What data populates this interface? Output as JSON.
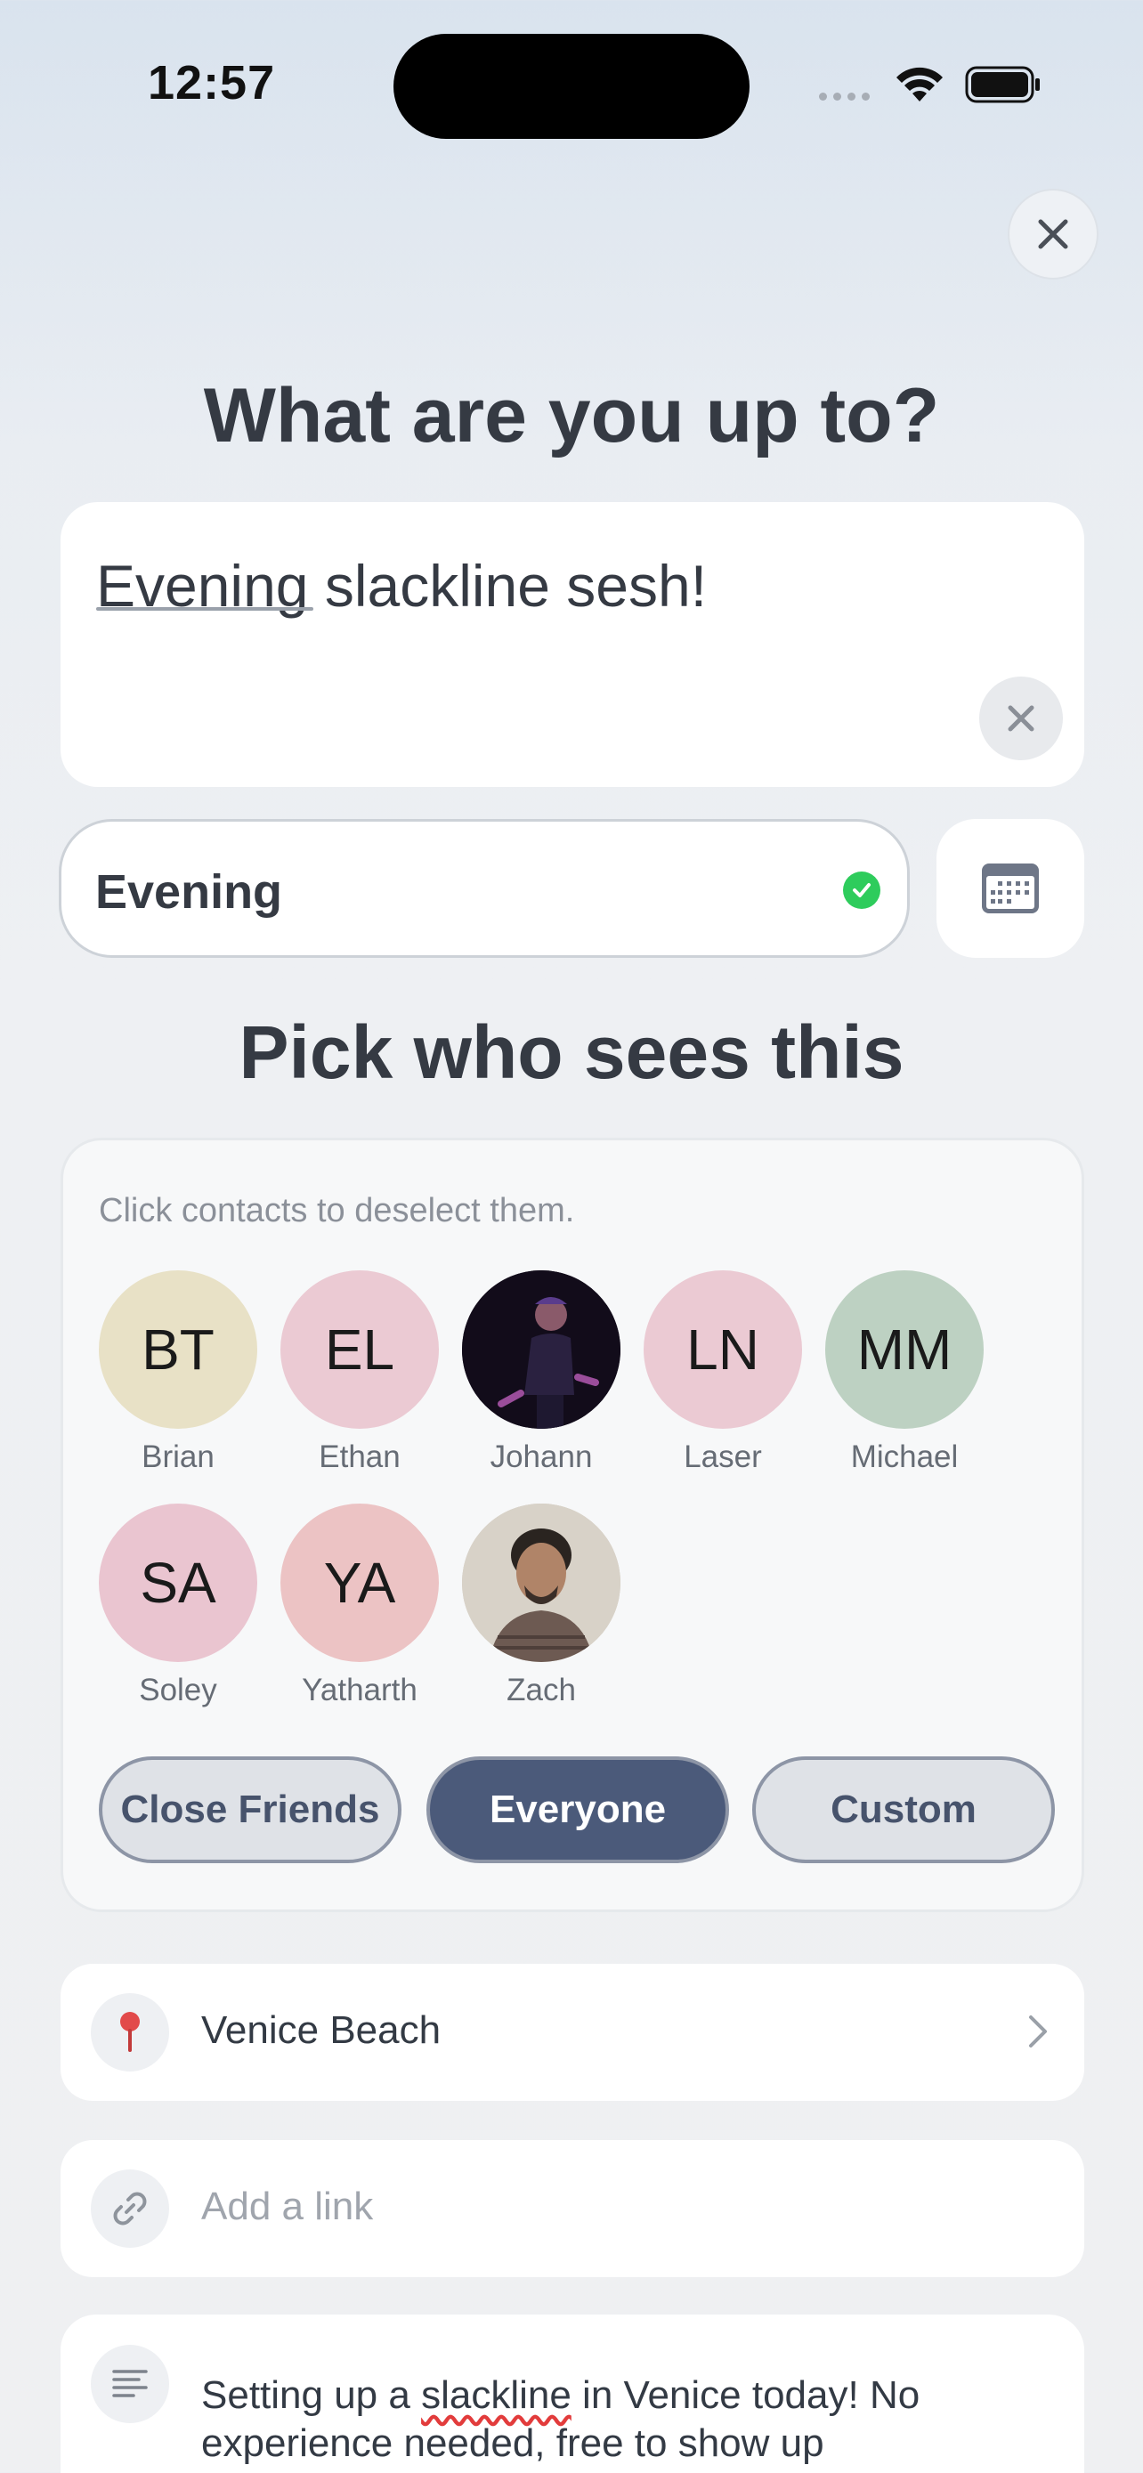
{
  "status_bar": {
    "time": "12:57"
  },
  "header": {
    "title": "What are you up to?"
  },
  "activity": {
    "value_underlined": "Evening",
    "value_rest": " slackline sesh!"
  },
  "time_field": {
    "value": "Evening"
  },
  "audience": {
    "title": "Pick who sees this",
    "hint": "Click contacts to deselect them.",
    "contacts": [
      {
        "initials": "BT",
        "name": "Brian",
        "color": "#e8e1c6"
      },
      {
        "initials": "EL",
        "name": "Ethan",
        "color": "#ebcad3"
      },
      {
        "initials": "",
        "name": "Johann",
        "color": "#1a1424",
        "photo": true
      },
      {
        "initials": "LN",
        "name": "Laser",
        "color": "#ebcad3"
      },
      {
        "initials": "MM",
        "name": "Michael",
        "color": "#bdd1c2"
      },
      {
        "initials": "SA",
        "name": "Soley",
        "color": "#eac5d0"
      },
      {
        "initials": "YA",
        "name": "Yatharth",
        "color": "#ecc3c4"
      },
      {
        "initials": "",
        "name": "Zach",
        "color": "#c9bfb1",
        "photo": true
      }
    ],
    "segments": [
      "Close Friends",
      "Everyone",
      "Custom"
    ],
    "selected_segment": "Everyone"
  },
  "location": {
    "value": "Venice Beach"
  },
  "link": {
    "placeholder": "Add a link"
  },
  "notes": {
    "before": "Setting up a ",
    "misspelled": "slackline",
    "after": " in Venice today! No experience needed, free to show up"
  },
  "colors": {
    "accent": "#4b5a7a",
    "check": "#2ecc5c",
    "pin": "#e24a4a"
  }
}
